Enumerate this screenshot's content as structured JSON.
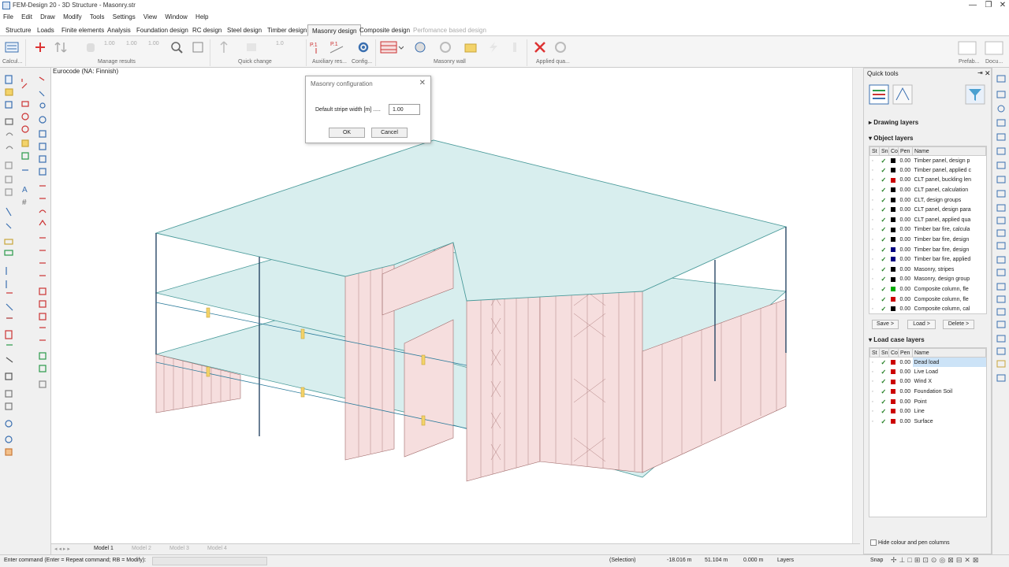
{
  "window": {
    "title": "FEM-Design 20 - 3D Structure - Masonry.str",
    "minimize": "—",
    "restore": "❐",
    "close": "✕"
  },
  "menu": [
    "File",
    "Edit",
    "Draw",
    "Modify",
    "Tools",
    "Settings",
    "View",
    "Window",
    "Help"
  ],
  "tabs": [
    {
      "label": "Structure"
    },
    {
      "label": "Loads"
    },
    {
      "label": "Finite elements"
    },
    {
      "label": "Analysis"
    },
    {
      "label": "Foundation design"
    },
    {
      "label": "RC design"
    },
    {
      "label": "Steel design"
    },
    {
      "label": "Timber design"
    },
    {
      "label": "Masonry design",
      "active": true
    },
    {
      "label": "Composite design"
    },
    {
      "label": "Perfomance based design",
      "disabled": true
    }
  ],
  "ribbon": {
    "groups": [
      "Calcul...",
      "Manage results",
      "Quick change",
      "Auxiliary res...",
      "Config...",
      "Masonry wall",
      "Applied qua...",
      "Prefab...",
      "Docu..."
    ],
    "digits": [
      "1.00",
      "1.00",
      "1.00",
      "1.0"
    ]
  },
  "canvas": {
    "code_label": "Eurocode (NA: Finnish)"
  },
  "dialog": {
    "title": "Masonry configuration",
    "label": "Default stripe width [m] .....",
    "value": "1.00",
    "ok": "OK",
    "cancel": "Cancel"
  },
  "quicktools": {
    "title": "Quick tools",
    "drawing_layers": "Drawing layers",
    "object_layers_title": "Object layers",
    "columns": [
      "St",
      "Sn",
      "Co",
      "Pen",
      "Name"
    ],
    "object_layers": [
      {
        "pen": "0.00",
        "color": "#000000",
        "name": "Timber panel, design p"
      },
      {
        "pen": "0.00",
        "color": "#000000",
        "name": "Timber panel, applied c"
      },
      {
        "pen": "0.00",
        "color": "#cc0000",
        "name": "CLT panel, buckling len"
      },
      {
        "pen": "0.00",
        "color": "#000000",
        "name": "CLT panel, calculation"
      },
      {
        "pen": "0.00",
        "color": "#000000",
        "name": "CLT, design groups"
      },
      {
        "pen": "0.00",
        "color": "#000000",
        "name": "CLT panel, design para"
      },
      {
        "pen": "0.00",
        "color": "#000000",
        "name": "CLT panel, applied qua"
      },
      {
        "pen": "0.00",
        "color": "#000000",
        "name": "Timber bar fire, calcula"
      },
      {
        "pen": "0.00",
        "color": "#000000",
        "name": "Timber bar fire, design"
      },
      {
        "pen": "0.00",
        "color": "#000080",
        "name": "Timber bar fire, design"
      },
      {
        "pen": "0.00",
        "color": "#000080",
        "name": "Timber bar fire, applied"
      },
      {
        "pen": "0.00",
        "color": "#000000",
        "name": "Masonry, stripes"
      },
      {
        "pen": "0.00",
        "color": "#000000",
        "name": "Masonry, design group"
      },
      {
        "pen": "0.00",
        "color": "#00aa00",
        "name": "Composite column, fle"
      },
      {
        "pen": "0.00",
        "color": "#cc0000",
        "name": "Composite column, fle"
      },
      {
        "pen": "0.00",
        "color": "#000000",
        "name": "Composite column, cal"
      }
    ],
    "save": "Save >",
    "load": "Load >",
    "delete": "Delete >",
    "load_case_title": "Load case layers",
    "load_cases": [
      {
        "pen": "0.00",
        "color": "#cc0000",
        "name": "Dead load",
        "selected": true
      },
      {
        "pen": "0.00",
        "color": "#cc0000",
        "name": "Live Load"
      },
      {
        "pen": "0.00",
        "color": "#cc0000",
        "name": "Wind X"
      },
      {
        "pen": "0.00",
        "color": "#cc0000",
        "name": "Foundation Soil"
      },
      {
        "pen": "0.00",
        "color": "#cc0000",
        "name": "Point"
      },
      {
        "pen": "0.00",
        "color": "#cc0000",
        "name": "Line"
      },
      {
        "pen": "0.00",
        "color": "#cc0000",
        "name": "Surface"
      }
    ],
    "hide_colour": "Hide colour and pen columns"
  },
  "model_tabs": [
    "Model 1",
    "Model 2",
    "Model 3",
    "Model 4"
  ],
  "status": {
    "command": "Enter command (Enter = Repeat command; RB = Modify):",
    "selection": "(Selection)",
    "x": "-18.016 m",
    "y": "51.104 m",
    "z": "0.000 m",
    "layers": "Layers",
    "snap": "Snap"
  },
  "colors": {
    "slab": "#d8eeee",
    "wall": "#f6dede",
    "edge": "#4a9a9a",
    "accent": "#3a6fb0"
  }
}
